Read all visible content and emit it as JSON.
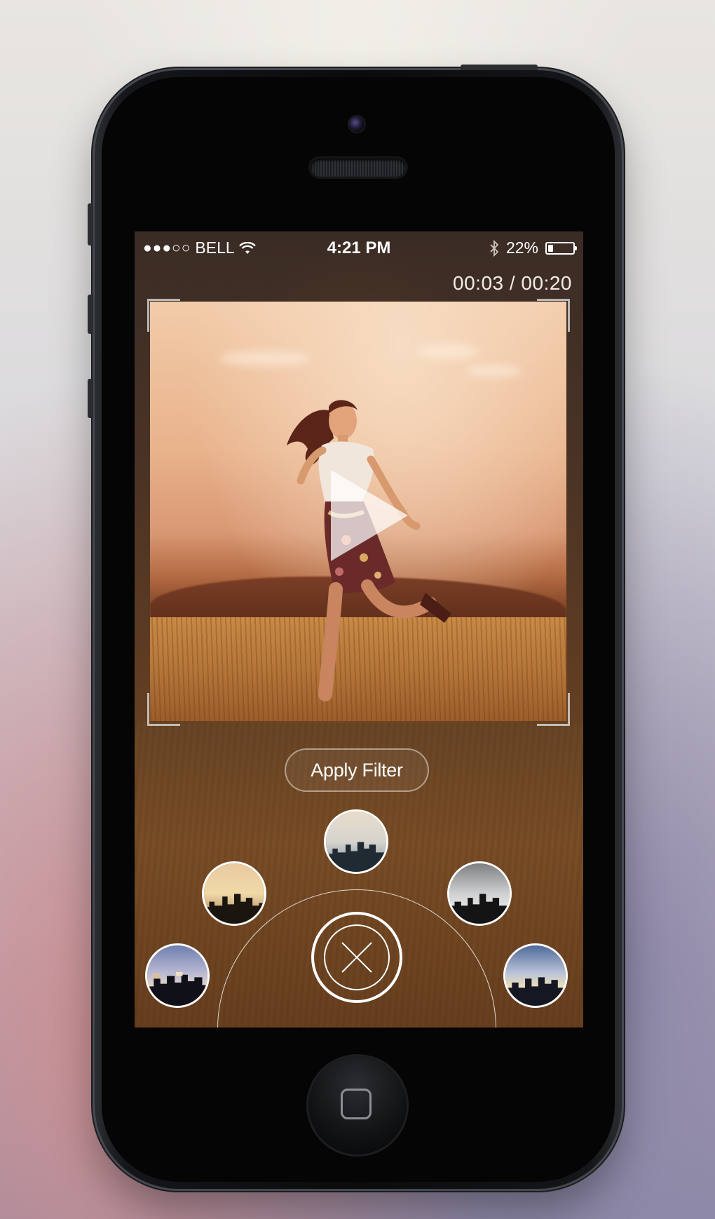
{
  "status_bar": {
    "signal": "●●●○○",
    "carrier": "BELL",
    "time": "4:21 PM",
    "battery_percent": "22%",
    "battery_level": 0.22,
    "icons": [
      "wifi-icon",
      "bluetooth-icon",
      "battery-icon"
    ]
  },
  "player": {
    "timecode": "00:03 / 00:20",
    "current": "00:03",
    "duration": "00:20",
    "play_icon": "play-icon"
  },
  "actions": {
    "apply_filter_label": "Apply Filter",
    "close_icon": "close-icon"
  },
  "filters": [
    {
      "name": "filter-1",
      "style": "pixelated"
    },
    {
      "name": "filter-2",
      "style": "warm"
    },
    {
      "name": "filter-3",
      "style": "cool"
    },
    {
      "name": "filter-4",
      "style": "mono"
    },
    {
      "name": "filter-5",
      "style": "vivid"
    }
  ],
  "colors": {
    "accent": "#ffffff",
    "screen_tint": "#5f3c22"
  }
}
